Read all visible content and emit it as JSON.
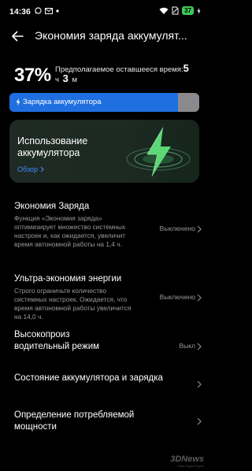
{
  "status_bar": {
    "time": "14:36",
    "battery_level": "37",
    "left_icons": [
      "whatsapp-icon",
      "gmail-icon",
      "notification-dot-icon"
    ],
    "right_icons": [
      "wifi-icon",
      "sim-off-icon",
      "battery-charging-icon"
    ]
  },
  "header": {
    "title": "Экономия заряда аккумулят..."
  },
  "battery": {
    "percent": "37%",
    "remaining_label": "Предполагаемое оставшееся время:",
    "hours_value": "5",
    "hours_unit": "ч",
    "minutes_value": "3",
    "minutes_unit": "м",
    "charge_level": 0.89,
    "charging_label": "Зарядка аккумулятора"
  },
  "usage_card": {
    "title": "Использование аккумулятора",
    "link": "Обзор"
  },
  "settings": [
    {
      "title": "Экономия Заряда",
      "desc": "Функция «Экономия заряда» оптимизирует множество системных настроек и, как ожидается, увеличит время автономной работы на 1,4 ч.",
      "value": "Выключено"
    },
    {
      "title": "Ультра-экономия энергии",
      "desc": "Строго ограничьте количество системных настроек. Ожидается, что время автономной работы увеличится на 14,0 ч.",
      "value": "Выключено"
    },
    {
      "title": "Высокопроиз водительный режим",
      "desc": "",
      "value": "Выкл"
    },
    {
      "title": "Состояние аккумулятора и зарядка",
      "desc": "",
      "value": ""
    },
    {
      "title": "Определение потребляемой мощности",
      "desc": "",
      "value": ""
    }
  ],
  "watermark": {
    "brand": "3DNews",
    "tagline": "Daily Digital Digest"
  },
  "colors": {
    "accent_blue": "#1f6fe0",
    "link_blue": "#3a8cff",
    "battery_green": "#3ec75a",
    "bolt_green": "#5fe07a"
  }
}
